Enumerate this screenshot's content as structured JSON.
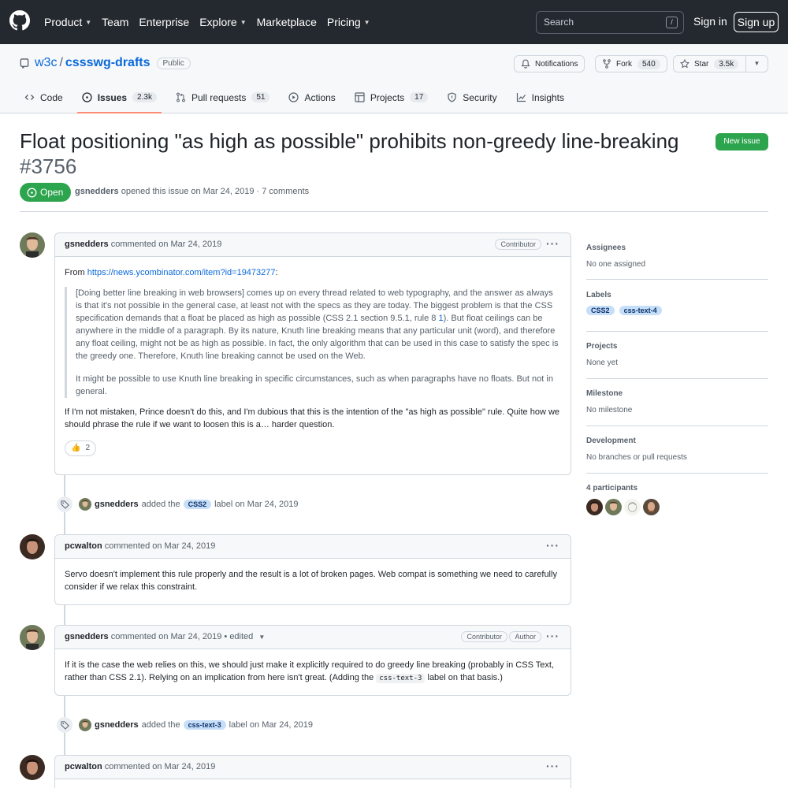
{
  "topnav": {
    "items": [
      {
        "label": "Product",
        "caret": true
      },
      {
        "label": "Team",
        "caret": false
      },
      {
        "label": "Enterprise",
        "caret": false
      },
      {
        "label": "Explore",
        "caret": true
      },
      {
        "label": "Marketplace",
        "caret": false
      },
      {
        "label": "Pricing",
        "caret": true
      }
    ],
    "search_placeholder": "Search",
    "search_shortcut": "/",
    "signin": "Sign in",
    "signup": "Sign up"
  },
  "repo": {
    "owner": "w3c",
    "separator": "/",
    "name": "cssswg-drafts",
    "visibility": "Public",
    "notifications": "Notifications",
    "fork_label": "Fork",
    "fork_count": "540",
    "star_label": "Star",
    "star_count": "3.5k"
  },
  "tabs": [
    {
      "label": "Code",
      "count": ""
    },
    {
      "label": "Issues",
      "count": "2.3k"
    },
    {
      "label": "Pull requests",
      "count": "51"
    },
    {
      "label": "Actions",
      "count": ""
    },
    {
      "label": "Projects",
      "count": "17"
    },
    {
      "label": "Security",
      "count": ""
    },
    {
      "label": "Insights",
      "count": ""
    }
  ],
  "issue": {
    "title": "Float positioning \"as high as possible\" prohibits non-greedy line-breaking",
    "number": "#3756",
    "new_issue": "New issue",
    "state": "Open",
    "author": "gsnedders",
    "meta_text": "opened this issue on Mar 24, 2019 · 7 comments"
  },
  "comments": [
    {
      "author": "gsnedders",
      "action": "commented on Mar 24, 2019",
      "badges": [
        "Contributor"
      ],
      "intro": "From ",
      "link": "https://news.ycombinator.com/item?id=19473277",
      "intro_after": ":",
      "quote_p1_a": "[Doing better line breaking in web browsers] comes up on every thread related to web typography, and the answer as always is that it's not possible in the general case, at least not with the specs as they are today. The biggest problem is that the CSS specification demands that a float be placed as high as possible (CSS 2.1 section 9.5.1, rule 8 ",
      "quote_p1_link": "1",
      "quote_p1_b": "). But float ceilings can be anywhere in the middle of a paragraph. By its nature, Knuth line breaking means that any particular unit (word), and therefore any float ceiling, might not be as high as possible. In fact, the only algorithm that can be used in this case to satisfy the spec is the greedy one. Therefore, Knuth line breaking cannot be used on the Web.",
      "quote_p2": "It might be possible to use Knuth line breaking in specific circumstances, such as when paragraphs have no floats. But not in general.",
      "text": "If I'm not mistaken, Prince doesn't do this, and I'm dubious that this is the intention of the \"as high as possible\" rule. Quite how we should phrase the rule if we want to loosen this is a… harder question.",
      "reaction_emoji": "👍",
      "reaction_count": "2"
    },
    {
      "author": "pcwalton",
      "action": "commented on Mar 24, 2019",
      "text": "Servo doesn't implement this rule properly and the result is a lot of broken pages. Web compat is something we need to carefully consider if we relax this constraint."
    },
    {
      "author": "gsnedders",
      "action": "commented on Mar 24, 2019",
      "edited": "• edited",
      "badges": [
        "Contributor",
        "Author"
      ],
      "text_a": "If it is the case the web relies on this, we should just make it explicitly required to do greedy line breaking (probably in CSS Text, rather than CSS 2.1). Relying on an implication from here isn't great. (Adding the ",
      "code": "css-text-3",
      "text_b": " label on that basis.)"
    },
    {
      "author": "pcwalton",
      "action": "commented on Mar 24, 2019"
    }
  ],
  "events": [
    {
      "author": "gsnedders",
      "pre": "added the",
      "label": "CSS2",
      "post": "label on Mar 24, 2019"
    },
    {
      "author": "gsnedders",
      "pre": "added the",
      "label": "css-text-3",
      "post": "label on Mar 24, 2019"
    }
  ],
  "sidebar": {
    "assignees_title": "Assignees",
    "assignees_value": "No one assigned",
    "labels_title": "Labels",
    "labels": [
      "CSS2",
      "css-text-4"
    ],
    "projects_title": "Projects",
    "projects_value": "None yet",
    "milestone_title": "Milestone",
    "milestone_value": "No milestone",
    "development_title": "Development",
    "development_value": "No branches or pull requests",
    "participants_title": "4 participants"
  },
  "colors": {
    "header_bg": "#24292f",
    "open_green": "#2da44e",
    "link_blue": "#0969da",
    "label_bg": "#c7def8",
    "active_tab_underline": "#fd8c73"
  }
}
